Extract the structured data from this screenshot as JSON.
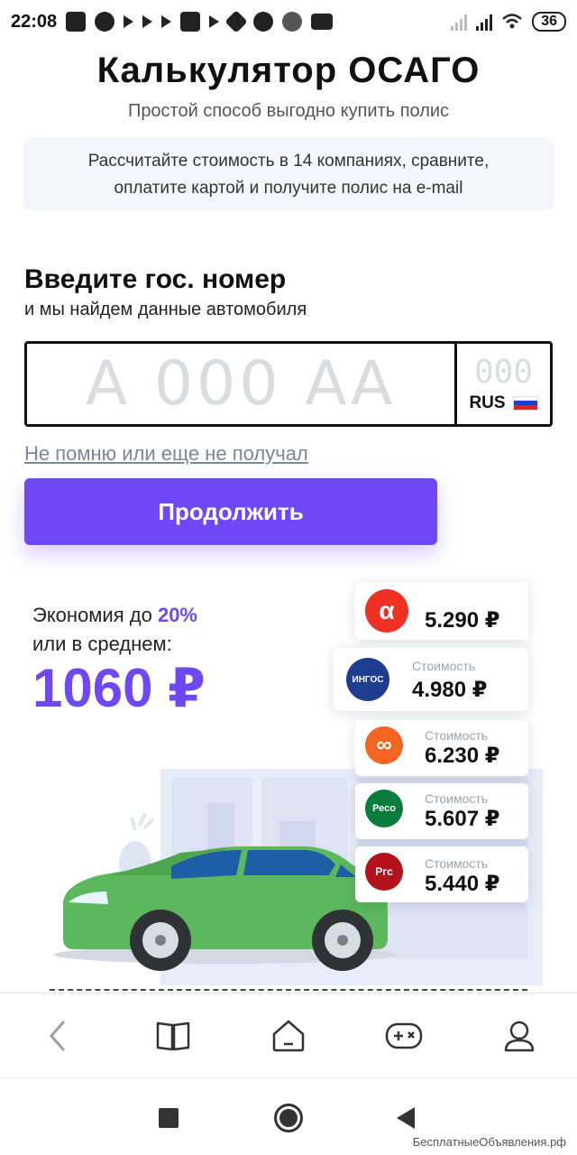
{
  "status_bar": {
    "time": "22:08",
    "battery": "36"
  },
  "header": {
    "title": "Калькулятор ОСАГО",
    "subtitle": "Простой способ выгодно купить полис"
  },
  "info": {
    "line1": "Рассчитайте стоимость в 14 компаниях, сравните,",
    "line2": "оплатите картой и получите полис на e-mail"
  },
  "plate_section": {
    "heading": "Введите гос. номер",
    "subheading": "и мы найдем данные автомобиля"
  },
  "plate_input": {
    "placeholder": "А 000 АА",
    "region_placeholder": "000",
    "country": "RUS"
  },
  "links": {
    "no_plate": "Не помню или еще не получал"
  },
  "buttons": {
    "continue": "Продолжить"
  },
  "savings": {
    "prefix": "Экономия до",
    "percent": "20%",
    "line2": "или в среднем:",
    "amount": "1060 ₽"
  },
  "offers": [
    {
      "logo_text": "α",
      "logo_color": "#ef3124",
      "caption": "",
      "price": "5.290 ₽"
    },
    {
      "logo_text": "ИНГОС",
      "logo_color": "#1d3d8f",
      "caption": "Стоимость",
      "price": "4.980 ₽"
    },
    {
      "logo_text": "∞",
      "logo_color": "#f26522",
      "caption": "Стоимость",
      "price": "6.230 ₽"
    },
    {
      "logo_text": "Ресо",
      "logo_color": "#0a7d3b",
      "caption": "Стоимость",
      "price": "5.607 ₽"
    },
    {
      "logo_text": "Ргс",
      "logo_color": "#b3121d",
      "caption": "Стоимость",
      "price": "5.440 ₽"
    }
  ],
  "bottom_nav": [
    "back-icon",
    "book-icon",
    "home-icon",
    "gamepad-icon",
    "profile-icon"
  ],
  "watermark": "БесплатныеОбъявления.рф",
  "colors": {
    "accent": "#6e48f4"
  }
}
